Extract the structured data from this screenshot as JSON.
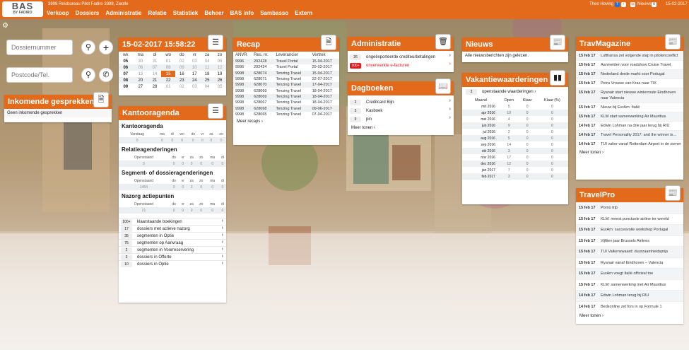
{
  "app": {
    "logo_line1": "BAS",
    "logo_line2": "BY FADIRO",
    "agency": "3998 Reisbureau Pilot Fadiro 3998, Zwolle"
  },
  "menu": [
    "Verkoop",
    "Dossiers",
    "Administratie",
    "Relatie",
    "Statistiek",
    "Beheer",
    "BAS info",
    "Sambasso",
    "Extern"
  ],
  "topright": {
    "user": "Theo Hoving",
    "badge1": "7",
    "nieuws_label": "Nieuws",
    "nieuws_count": "0",
    "date": "15-02-2017"
  },
  "colors": {
    "accent": "#e26a1a",
    "alert": "#e31b1b"
  },
  "search": {
    "dossier_placeholder": "Dossiernummer",
    "postcode_placeholder": "Postcode/Tel."
  },
  "inkomende": {
    "title": "Inkomende gesprekken",
    "empty": "Geen inkomende gesprekken"
  },
  "calendar": {
    "title": "15-02-2017 15:58:22",
    "headers": [
      "wk",
      "ma",
      "di",
      "wo",
      "do",
      "vr",
      "za",
      "zo"
    ],
    "rows": [
      [
        "05",
        "30",
        "31",
        "01",
        "02",
        "03",
        "04",
        "05"
      ],
      [
        "06",
        "06",
        "07",
        "08",
        "09",
        "10",
        "11",
        "12"
      ],
      [
        "07",
        "13",
        "14",
        "15",
        "16",
        "17",
        "18",
        "19"
      ],
      [
        "08",
        "20",
        "21",
        "22",
        "23",
        "24",
        "25",
        "26"
      ],
      [
        "09",
        "27",
        "28",
        "01",
        "02",
        "03",
        "04",
        "05"
      ]
    ]
  },
  "kantoor": {
    "title": "Kantooragenda",
    "sections": [
      {
        "title": "Kantooragenda",
        "headers": [
          "Vandaag",
          "ma",
          "di",
          "wo",
          "do",
          "vr",
          "za",
          "zo"
        ],
        "values": [
          "0",
          "0",
          "0",
          "0",
          "0",
          "0",
          "0",
          "0"
        ]
      },
      {
        "title": "Relatieagenderingen",
        "headers": [
          "Openstaand",
          "do",
          "vr",
          "za",
          "zo",
          "ma",
          "di"
        ],
        "values": [
          "5",
          "0",
          "0",
          "0",
          "0",
          "0",
          "0"
        ]
      },
      {
        "title": "Segment- of dossieragenderingen",
        "headers": [
          "Openstaand",
          "do",
          "vr",
          "za",
          "zo",
          "ma",
          "di"
        ],
        "values": [
          "1454",
          "0",
          "0",
          "3",
          "0",
          "0",
          "0"
        ]
      },
      {
        "title": "Nazorg actiepunten",
        "headers": [
          "Openstaand",
          "do",
          "vr",
          "za",
          "zo",
          "ma",
          "di"
        ],
        "values": [
          "21",
          "0",
          "0",
          "0",
          "0",
          "0",
          "0"
        ]
      }
    ],
    "items": [
      {
        "badge": "100+",
        "label": "klaarstaande boekingen"
      },
      {
        "badge": "17",
        "label": "dossiers met actieve nazorg"
      },
      {
        "badge": "35",
        "label": "segmenten in Optie"
      },
      {
        "badge": "75",
        "label": "segmenten op Aanvraag"
      },
      {
        "badge": "2",
        "label": "segmenten in Voorreservering"
      },
      {
        "badge": "3",
        "label": "dossiers in Offerte"
      },
      {
        "badge": "10",
        "label": "dossiers in Optie"
      }
    ]
  },
  "recap": {
    "title": "Recap",
    "headers": [
      "ANVR",
      "Res. nr.",
      "Leverancier",
      "Vertrek"
    ],
    "rows": [
      [
        "9996",
        "202428",
        "Travel Portal",
        "15-04-2017"
      ],
      [
        "9996",
        "202424",
        "Travel Portal",
        "29-03-2017"
      ],
      [
        "9998",
        "628074",
        "Tenzing Travel",
        "15-04-2017"
      ],
      [
        "9998",
        "628071",
        "Tenzing Travel",
        "22-07-2017"
      ],
      [
        "9998",
        "628070",
        "Tenzing Travel",
        "17-04-2017"
      ],
      [
        "9998",
        "628069",
        "Tenzing Travel",
        "18-04-2017"
      ],
      [
        "9998",
        "628069",
        "Tenzing Travel",
        "18-04-2017"
      ],
      [
        "9998",
        "628067",
        "Tenzing Travel",
        "18-04-2017"
      ],
      [
        "9998",
        "628068",
        "Tenzing Travel",
        "09-06-2017"
      ],
      [
        "9998",
        "628065",
        "Tenzing Travel",
        "07-04-2017"
      ]
    ],
    "more": "Meer recaps"
  },
  "administratie": {
    "title": "Administratie",
    "items": [
      {
        "badge": "26",
        "label": "ongeëxporteerde crediteurbetalingen",
        "red": false
      },
      {
        "badge": "100+",
        "label": "onverwerkte e-facturen",
        "red": true
      }
    ]
  },
  "dagboeken": {
    "title": "Dagboeken",
    "items": [
      {
        "badge": "2",
        "label": "Creditcard Bijn"
      },
      {
        "badge": "3",
        "label": "Kasboek"
      },
      {
        "badge": "9",
        "label": "pin"
      }
    ],
    "more": "Meer tonen"
  },
  "nieuws": {
    "title": "Nieuws",
    "text": "Alle nieuwsberichten zijn gelezen."
  },
  "vakantie": {
    "title": "Vakantiewaarderingen",
    "badge": "3",
    "label": "openstaande waarderingen",
    "headers": [
      "Maand",
      "Open",
      "Klaar",
      "Klaar (%)"
    ],
    "rows": [
      [
        "mrt 2016",
        "5",
        "0",
        "0"
      ],
      [
        "apr 2016",
        "10",
        "0",
        "0"
      ],
      [
        "mei 2016",
        "4",
        "0",
        "0"
      ],
      [
        "jun 2016",
        "9",
        "0",
        "0"
      ],
      [
        "jul 2016",
        "2",
        "0",
        "0"
      ],
      [
        "aug 2016",
        "5",
        "0",
        "0"
      ],
      [
        "sep 2016",
        "14",
        "0",
        "0"
      ],
      [
        "okt 2016",
        "3",
        "0",
        "0"
      ],
      [
        "nov 2016",
        "17",
        "0",
        "0"
      ],
      [
        "dec 2016",
        "12",
        "0",
        "0"
      ],
      [
        "jan 2017",
        "7",
        "0",
        "0"
      ],
      [
        "feb 2017",
        "3",
        "0",
        "0"
      ]
    ]
  },
  "travmagazine": {
    "title": "TravMagazine",
    "items": [
      {
        "date": "15 feb 17",
        "text": "Lufthansa zet volgende stap in pilotenconflict",
        "tall": false
      },
      {
        "date": "15 feb 17",
        "text": "Aanmelden voor roadshow Cruise Travel",
        "tall": false
      },
      {
        "date": "15 feb 17",
        "text": "Nederland derde markt voor Portugal",
        "tall": false
      },
      {
        "date": "15 feb 17",
        "text": "Petra Vrouwe van Kras naar TIX",
        "tall": false
      },
      {
        "date": "15 feb 17",
        "text": "Ryanair start nieuwe winterroute Eindhoven naar Valencia",
        "tall": true
      },
      {
        "date": "15 feb 17",
        "text": "Nieuw bij EurAm: Italië",
        "tall": false
      },
      {
        "date": "15 feb 17",
        "text": "KLM start samenwerking Air Mauritius",
        "tall": false
      },
      {
        "date": "14 feb 17",
        "text": "Edwin Lohman na drie jaar terug bij RIU",
        "tall": false
      },
      {
        "date": "14 feb 17",
        "text": "Travel Personality 2017: and the winner is…",
        "tall": false
      },
      {
        "date": "14 feb 17",
        "text": "TUI vaker vanaf Rotterdam Airport in de zomer",
        "tall": false
      }
    ],
    "more": "Meer tonen"
  },
  "travelpro": {
    "title": "TravelPro",
    "items": [
      {
        "date": "15 feb 17",
        "text": "Porno trip"
      },
      {
        "date": "15 feb 17",
        "text": "KLM: meest punctuele airline ter wereld"
      },
      {
        "date": "15 feb 17",
        "text": "EurAm: succesvolle workshop Portugal"
      },
      {
        "date": "15 feb 17",
        "text": "Vijftien jaar Brussels Airlines"
      },
      {
        "date": "15 feb 17",
        "text": "TUI Valkenswaard: duurzaamheidsprijs"
      },
      {
        "date": "15 feb 17",
        "text": "Ryanair vanaf Eindhoven – Valencia"
      },
      {
        "date": "15 feb 17",
        "text": "EurAm voegt Italië officieel toe"
      },
      {
        "date": "15 feb 17",
        "text": "KLM: samenwerking met Air Mauritius"
      },
      {
        "date": "14 feb 17",
        "text": "Edwin Lohman terug bij RIU"
      },
      {
        "date": "14 feb 17",
        "text": "Bedsonline zet fors in op Formule 1"
      }
    ],
    "more": "Meer tonen"
  }
}
